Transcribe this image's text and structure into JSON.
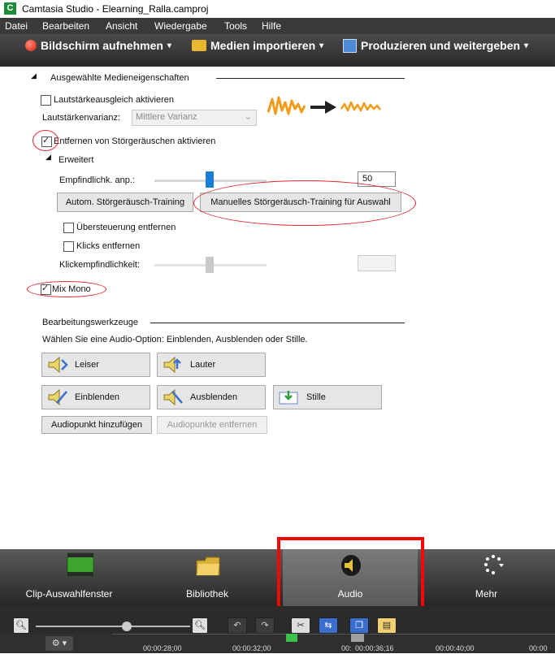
{
  "window": {
    "title": "Camtasia Studio - Elearning_Ralla.camproj",
    "icon_letter": "C"
  },
  "menu": [
    "Datei",
    "Bearbeiten",
    "Ansicht",
    "Wiedergabe",
    "Tools",
    "Hilfe"
  ],
  "toolbar": {
    "record": "Bildschirm aufnehmen",
    "import": "Medien importieren",
    "produce": "Produzieren und weitergeben",
    "caret": "▾"
  },
  "properties": {
    "header": "Ausgewählte Medieneigenschaften",
    "volume_leveling": {
      "label": "Lautstärkeausgleich aktivieren",
      "checked": false
    },
    "variance_label": "Lautstärkenvarianz:",
    "variance_value": "Mittlere Varianz",
    "noise_removal": {
      "label": "Entfernen von Störgeräuschen aktivieren",
      "checked": true
    },
    "advanced": "Erweitert",
    "sensitivity_label": "Empfindlichk. anp.:",
    "sensitivity_value": "50",
    "auto_training": "Autom. Störgeräusch-Training",
    "manual_training": "Manuelles Störgeräusch-Training für Auswahl",
    "remove_clipping": {
      "label": "Übersteuerung entfernen",
      "checked": false
    },
    "remove_clicks": {
      "label": "Klicks entfernen",
      "checked": false
    },
    "click_sensitivity_label": "Klickempfindlichkeit:",
    "mix_mono": {
      "label": "Mix Mono",
      "checked": true
    }
  },
  "editing": {
    "header": "Bearbeitungswerkzeuge",
    "hint": "Wählen Sie eine Audio-Option: Einblenden, Ausblenden oder Stille.",
    "quieter": "Leiser",
    "louder": "Lauter",
    "fade_in": "Einblenden",
    "fade_out": "Ausblenden",
    "silence": "Stille",
    "add_point": "Audiopunkt hinzufügen",
    "remove_points": "Audiopunkte entfernen"
  },
  "tabs": [
    {
      "label": "Clip-Auswahlfenster",
      "icon": "filmstrip-icon"
    },
    {
      "label": "Bibliothek",
      "icon": "folder-icon"
    },
    {
      "label": "Audio",
      "icon": "speaker-icon",
      "active": true
    },
    {
      "label": "Mehr",
      "icon": "more-dots-icon"
    }
  ],
  "timeline": {
    "timecodes": [
      "00:00:28;00",
      "00:00:32;00",
      "00:00:36;16",
      "00:00:40;00",
      "00:00"
    ],
    "playhead_prefix": "00:"
  },
  "colors": {
    "highlight": "#e0242a",
    "slider_thumb": "#1a7fd8",
    "dark_bar": "#2b2b2b"
  }
}
